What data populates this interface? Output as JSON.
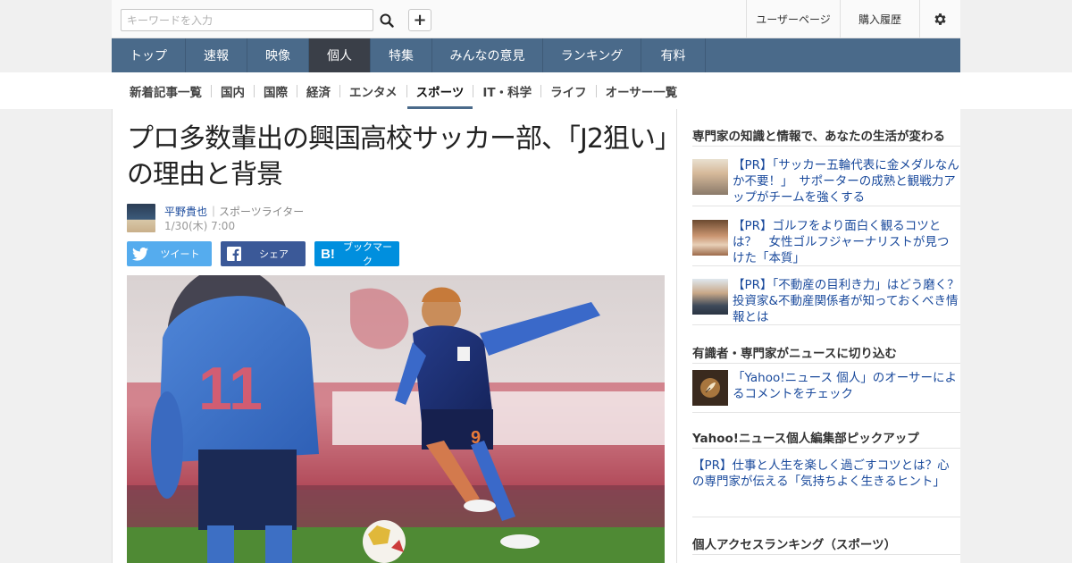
{
  "search": {
    "placeholder": "キーワードを入力"
  },
  "toplinks": {
    "user": "ユーザーページ",
    "history": "購入履歴"
  },
  "mainnav": [
    {
      "label": "トップ"
    },
    {
      "label": "速報"
    },
    {
      "label": "映像"
    },
    {
      "label": "個人"
    },
    {
      "label": "特集"
    },
    {
      "label": "みんなの意見"
    },
    {
      "label": "ランキング"
    },
    {
      "label": "有料"
    }
  ],
  "subnav": [
    {
      "label": "新着記事一覧"
    },
    {
      "label": "国内"
    },
    {
      "label": "国際"
    },
    {
      "label": "経済"
    },
    {
      "label": "エンタメ"
    },
    {
      "label": "スポーツ"
    },
    {
      "label": "IT・科学"
    },
    {
      "label": "ライフ"
    },
    {
      "label": "オーサー一覧"
    }
  ],
  "article": {
    "title": "プロ多数輩出の興国高校サッカー部、「J2狙い」の理由と背景",
    "author": "平野貴也",
    "role": "スポーツライター",
    "date": "1/30(木) 7:00",
    "share": {
      "tweet": "ツイート",
      "facebook": "シェア",
      "hatena": "ブックマーク"
    },
    "photo_numbers": {
      "back_player": "11",
      "front_player": "9"
    }
  },
  "sidebar": {
    "section1_title": "専門家の知識と情報で、あなたの生活が変わる",
    "pr_items": [
      {
        "text": "【PR】「サッカー五輪代表に金メダルなんか不要！」　サポーターの成熟と観戦力アップがチームを強くする"
      },
      {
        "text": "【PR】ゴルフをより面白く観るコツとは？　女性ゴルフジャーナリストが見つけた「本質」"
      },
      {
        "text": "【PR】「不動産の目利き力」はどう磨く？　投資家&不動産関係者が知っておくべき情報とは"
      }
    ],
    "section2_title": "有識者・専門家がニュースに切り込む",
    "comment_link": "「Yahoo!ニュース 個人」のオーサーによるコメントをチェック",
    "section3_title": "Yahoo!ニュース個人編集部ピックアップ",
    "pickup_link": "【PR】仕事と人生を楽しく過ごすコツとは？心の専門家が伝える「気持ちよく生きるヒント」",
    "section4_title": "個人アクセスランキング（スポーツ）"
  },
  "colors": {
    "nav": "#4a6a8a",
    "nav_active": "#3a3f48",
    "twitter": "#55acee",
    "facebook": "#3b5998",
    "hatena": "#008fde",
    "link": "#1a4a9c"
  }
}
